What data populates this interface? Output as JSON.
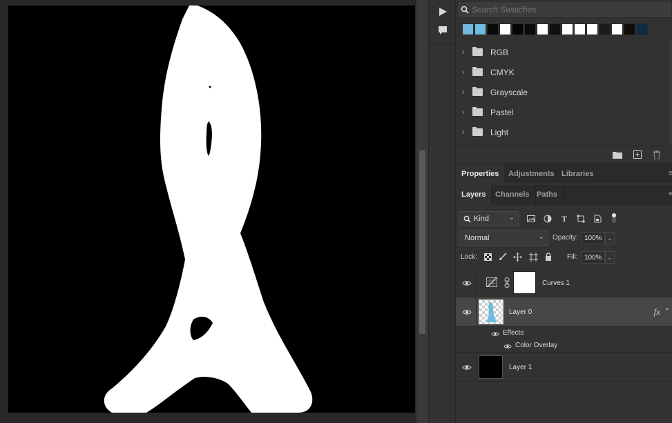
{
  "tools": {
    "play_icon": "play-icon",
    "comment_icon": "comment-icon"
  },
  "swatches": {
    "search_placeholder": "Search Swatches",
    "recent_colors": [
      "#73b8dd",
      "#6fbce1",
      "#0a0a0a",
      "#ffffff",
      "#050505",
      "#0b0b0b",
      "#ffffff",
      "#101010",
      "#ffffff",
      "#ffffff",
      "#ffffff",
      "#1b1b1b",
      "#ffffff",
      "#0d0d0d",
      "#0e2a45"
    ],
    "groups": [
      {
        "label": "RGB"
      },
      {
        "label": "CMYK"
      },
      {
        "label": "Grayscale"
      },
      {
        "label": "Pastel"
      },
      {
        "label": "Light"
      }
    ]
  },
  "properties_tabs": [
    "Properties",
    "Adjustments",
    "Libraries"
  ],
  "layers_panel": {
    "tabs": [
      "Layers",
      "Channels",
      "Paths"
    ],
    "filter_kind": "Kind",
    "blend_mode": "Normal",
    "opacity_label": "Opacity:",
    "opacity_value": "100%",
    "lock_label": "Lock:",
    "fill_label": "Fill:",
    "fill_value": "100%",
    "layers": [
      {
        "name": "Curves 1",
        "type": "adjustment"
      },
      {
        "name": "Layer 0",
        "type": "pixel",
        "fx": "fx",
        "effects_label": "Effects",
        "effects": [
          "Color Overlay"
        ]
      },
      {
        "name": "Layer 1",
        "type": "pixel"
      }
    ]
  },
  "colors": {
    "accent_thumb": "#6fbce1",
    "panel_bg": "#323232",
    "selected_row": "#474747"
  }
}
